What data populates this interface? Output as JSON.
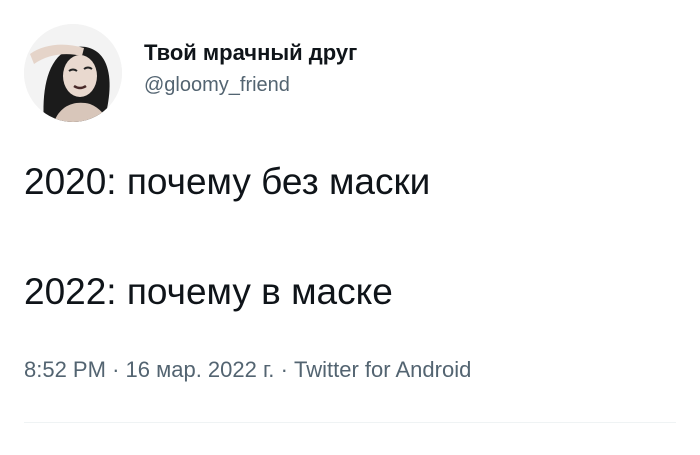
{
  "author": {
    "display_name": "Твой мрачный друг",
    "handle": "@gloomy_friend",
    "avatar_icon": "profile-photo"
  },
  "tweet": {
    "lines": [
      "2020: почему без маски",
      "2022: почему в маске"
    ],
    "time": "8:52 PM",
    "separator": "·",
    "date": "16 мар. 2022 г.",
    "source": "Twitter for Android"
  },
  "colors": {
    "text_primary": "#0f1419",
    "text_secondary": "#536471",
    "divider": "#eff3f4"
  }
}
